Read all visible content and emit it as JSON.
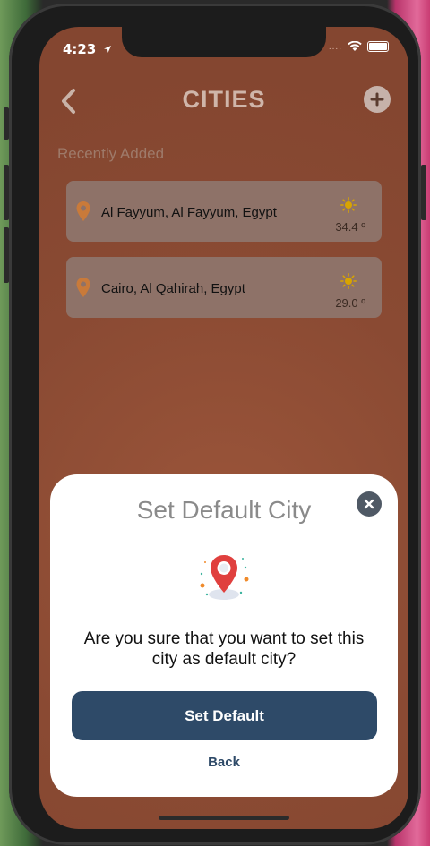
{
  "status_bar": {
    "time": "4:23",
    "signal_dots": "....",
    "icons": [
      "location-arrow-icon",
      "wifi-icon",
      "battery-icon"
    ]
  },
  "header": {
    "title": "CITIES",
    "back_icon": "chevron-left-icon",
    "add_icon": "plus-icon"
  },
  "section": {
    "label": "Recently Added"
  },
  "cities": [
    {
      "name": "Al Fayyum, Al Fayyum, Egypt",
      "temp": "34.4 º",
      "icon": "sun-icon"
    },
    {
      "name": "Cairo, Al Qahirah, Egypt",
      "temp": "29.0 º",
      "icon": "sun-icon"
    }
  ],
  "modal": {
    "title": "Set Default City",
    "message": "Are you sure that you want to set this city as default city?",
    "primary_label": "Set Default",
    "secondary_label": "Back",
    "close_icon": "close-icon",
    "illustration": "location-pin-icon"
  },
  "colors": {
    "background": "#8a4a33",
    "card": "#8e7268",
    "primary_button": "#2e4a68",
    "pin": "#e0403e"
  }
}
